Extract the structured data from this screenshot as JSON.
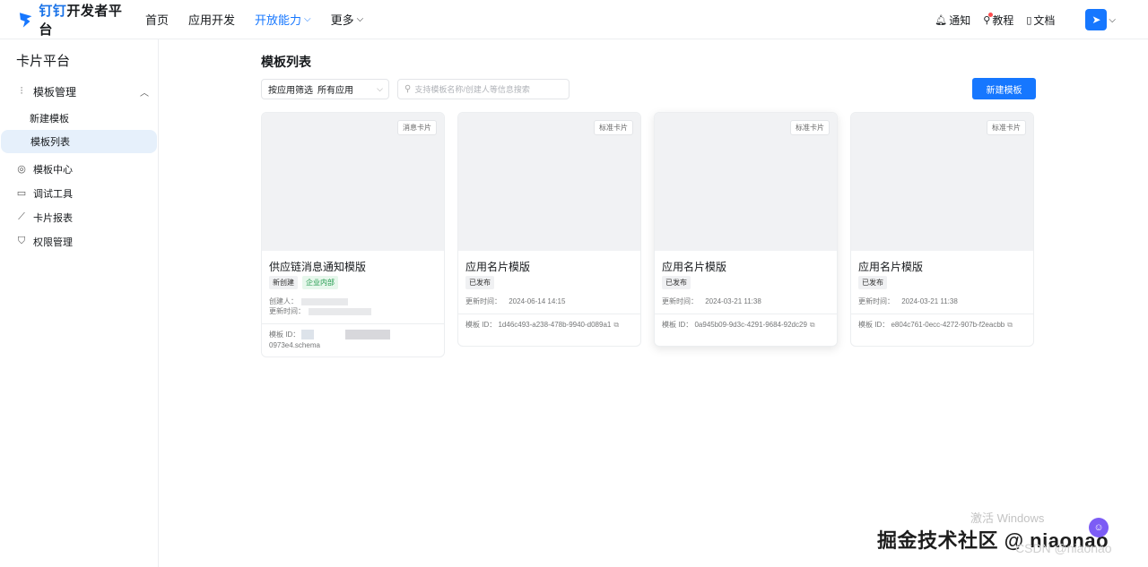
{
  "app": {
    "logo_brand": "钉钉",
    "logo_suffix": "开发者平台"
  },
  "nav": {
    "items": [
      {
        "label": "首页"
      },
      {
        "label": "应用开发"
      },
      {
        "label": "开放能力"
      },
      {
        "label": "更多"
      }
    ]
  },
  "top_right": {
    "notify": "通知",
    "tutorial": "教程",
    "docs": "文档"
  },
  "sidebar": {
    "title": "卡片平台",
    "group_label": "模板管理",
    "sub_items": [
      {
        "label": "新建模板"
      },
      {
        "label": "模板列表"
      }
    ],
    "items": [
      {
        "label": "模板中心",
        "icon": "target-icon"
      },
      {
        "label": "调试工具",
        "icon": "monitor-icon"
      },
      {
        "label": "卡片报表",
        "icon": "chart-icon"
      },
      {
        "label": "权限管理",
        "icon": "shield-icon"
      }
    ]
  },
  "main": {
    "title": "模板列表",
    "filter_label": "按应用筛选",
    "filter_value": "所有应用",
    "search_placeholder": "支持模板名称/创建人等信息搜索",
    "new_button": "新建模板"
  },
  "cards": [
    {
      "type": "消息卡片",
      "name": "供应链消息通知模版",
      "tags": [
        "新创建",
        "企业内部"
      ],
      "creator_label": "创建人：",
      "updated_label": "更新时间：",
      "id_label": "模板 ID：",
      "id_suffix": "0973e4.schema"
    },
    {
      "type": "标准卡片",
      "name": "应用名片模版",
      "tags": [
        "已发布"
      ],
      "updated_label": "更新时间：",
      "updated": "2024-06-14 14:15",
      "id_label": "模板 ID：",
      "id_value": "1d46c493-a238-478b-9940-d089a1"
    },
    {
      "type": "标准卡片",
      "name": "应用名片模版",
      "tags": [
        "已发布"
      ],
      "updated_label": "更新时间：",
      "updated": "2024-03-21 11:38",
      "id_label": "模板 ID：",
      "id_value": "0a945b09-9d3c-4291-9684-92dc29"
    },
    {
      "type": "标准卡片",
      "name": "应用名片模版",
      "tags": [
        "已发布"
      ],
      "updated_label": "更新时间：",
      "updated": "2024-03-21 11:38",
      "id_label": "模板 ID：",
      "id_value": "e804c761-0ecc-4272-907b-f2eacbb"
    }
  ],
  "watermarks": {
    "windows": "激活 Windows",
    "site": "掘金技术社区 @ niaonao",
    "csdn": "CSDN @niaonao"
  },
  "colors": {
    "accent": "#1677ff",
    "sidebar_active_bg": "#e6f0fb",
    "tag_green": "#1f9a4b"
  }
}
